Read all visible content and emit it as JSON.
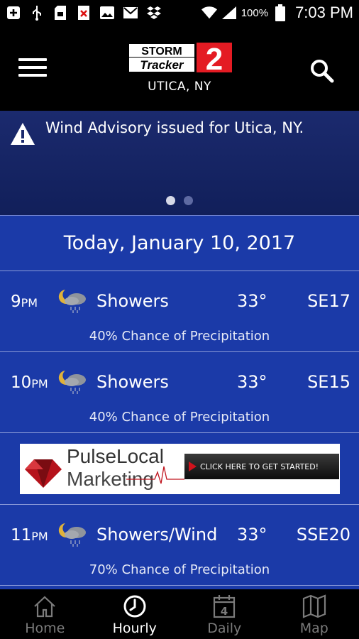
{
  "status_bar": {
    "icons": [
      "add-box-icon",
      "usb-icon",
      "sd-card-icon",
      "blocked-icon",
      "image-icon",
      "gmail-icon",
      "dropbox-icon",
      "wifi-icon",
      "signal-icon",
      "battery-icon"
    ],
    "battery": "100%",
    "time": "7:03 PM"
  },
  "header": {
    "logo_line1": "STORM",
    "logo_line2": "Tracker",
    "logo_number": "2",
    "location": "UTICA, NY"
  },
  "alert": {
    "text": "Wind Advisory issued for Utica, NY.",
    "page_count": 2,
    "active_page": 1
  },
  "forecast": {
    "date": "Today, January 10, 2017",
    "hours": [
      {
        "hour": "9",
        "ampm": "PM",
        "icon": "night-showers-icon",
        "condition": "Showers",
        "temp": "33°",
        "wind": "SE17",
        "precip": "40% Chance of Precipitation"
      },
      {
        "hour": "10",
        "ampm": "PM",
        "icon": "night-showers-icon",
        "condition": "Showers",
        "temp": "33°",
        "wind": "SE15",
        "precip": "40% Chance of Precipitation"
      },
      {
        "hour": "11",
        "ampm": "PM",
        "icon": "night-showers-icon",
        "condition": "Showers/Wind",
        "temp": "33°",
        "wind": "SSE20",
        "precip": "70% Chance of Precipitation"
      }
    ]
  },
  "ad": {
    "brand_line1": "PulseLocal",
    "brand_line2": "Marketing",
    "cta": "CLICK HERE TO GET STARTED!"
  },
  "bottom_nav": {
    "items": [
      {
        "label": "Home",
        "icon": "home-icon",
        "active": false
      },
      {
        "label": "Hourly",
        "icon": "clock-icon",
        "active": true
      },
      {
        "label": "Daily",
        "icon": "calendar-icon",
        "active": false,
        "badge": "4"
      },
      {
        "label": "Map",
        "icon": "map-icon",
        "active": false
      }
    ]
  },
  "colors": {
    "header_bg": "#000000",
    "alert_bg": "#1b2a6e",
    "content_bg": "#1b3aa8",
    "logo_red": "#e41b23"
  }
}
